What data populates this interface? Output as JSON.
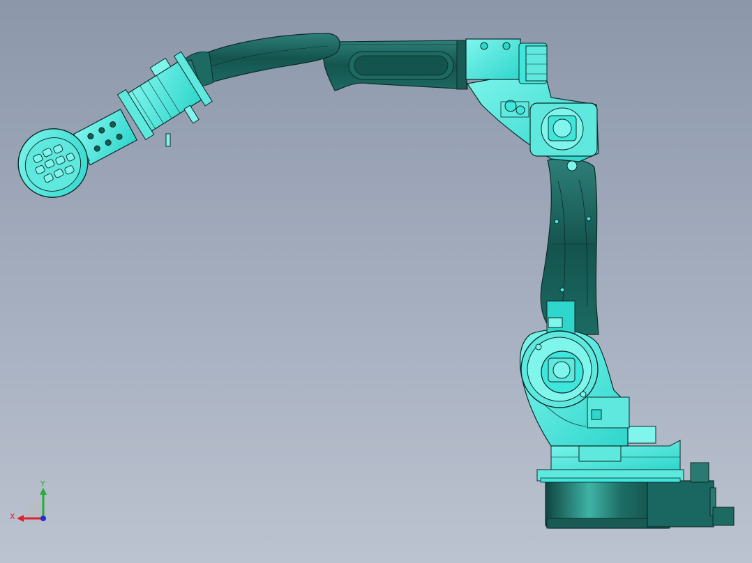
{
  "viewport": {
    "background_top": "#8c97aa",
    "background_bottom": "#bcc3d0"
  },
  "model": {
    "colors": {
      "link_dark": "#1a6660",
      "link_mid": "#2e8a80",
      "joint_cyan": "#3fe6dc",
      "joint_light": "#7ff5ec",
      "edge": "#0b2a28"
    }
  },
  "triad": {
    "x_label": "X",
    "y_label": "Y",
    "x_color": "#e0202a",
    "y_color": "#22b030",
    "z_color": "#2030d0"
  }
}
